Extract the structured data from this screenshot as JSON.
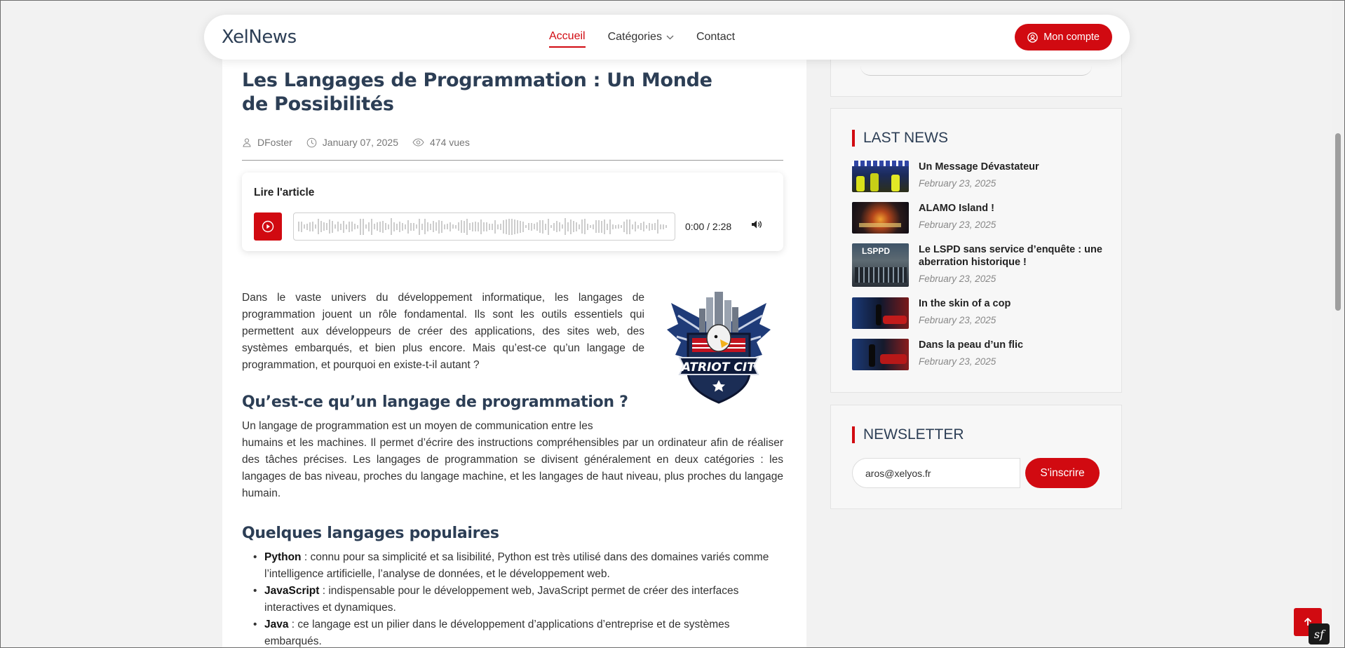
{
  "header": {
    "brand": "XelNews",
    "nav": [
      {
        "label": "Accueil"
      },
      {
        "label": "Catégories"
      },
      {
        "label": "Contact"
      }
    ],
    "account_label": "Mon compte"
  },
  "article": {
    "title": "Les Langages de Programmation : Un Monde de Possibilités",
    "author": "DFoster",
    "date": "January 07, 2025",
    "views": "474 vues",
    "player": {
      "label": "Lire l'article",
      "time": "0:00 / 2:28"
    },
    "logo_text": "PATRIOT CITY",
    "intro": "Dans le vaste univers du développement informatique, les langages de programmation jouent un rôle fondamental. Ils sont les outils essentiels qui permettent aux développeurs de créer des applications, des sites web, des systèmes embarqués, et bien plus encore. Mais qu’est-ce qu’un langage de programmation, et pourquoi en existe-t-il autant ?",
    "section1_title": "Qu’est-ce qu’un langage de programmation ?",
    "section1_first": "Un langage de programmation est un moyen de communication entre les",
    "section1_rest": "humains et les machines. Il permet d’écrire des instructions compréhensibles par un ordinateur afin de réaliser des tâches précises. Les langages de programmation se divisent généralement en deux catégories : les langages de bas niveau, proches du langage machine, et les langages de haut niveau, plus proches du langage humain.",
    "section2_title": "Quelques langages populaires",
    "languages": [
      {
        "name": "Python",
        "desc": " : connu pour sa simplicité et sa lisibilité, Python est très utilisé dans des domaines variés comme l’intelligence artificielle, l’analyse de données, et le développement web."
      },
      {
        "name": "JavaScript",
        "desc": " : indispensable pour le développement web, JavaScript permet de créer des interfaces interactives et dynamiques."
      },
      {
        "name": "Java",
        "desc": " : ce langage est un pilier dans le développement d’applications d’entreprise et de systèmes embarqués."
      }
    ]
  },
  "sidebar": {
    "last_news_title": "LAST NEWS",
    "news": [
      {
        "title": "Un Message Dévastateur",
        "date": "February 23, 2025"
      },
      {
        "title": "ALAMO Island !",
        "date": "February 23, 2025"
      },
      {
        "title": "Le LSPD sans service d’enquête : une aberration historique !",
        "date": "February 23, 2025",
        "thumb_text": "LSPPD"
      },
      {
        "title": "In the skin of a cop",
        "date": "February 23, 2025"
      },
      {
        "title": "Dans la peau d’un flic",
        "date": "February 23, 2025"
      }
    ],
    "newsletter_title": "NEWSLETTER",
    "newsletter_value": "aros@xelyos.fr",
    "newsletter_button": "S'inscrire"
  },
  "colors": {
    "accent": "#d10a11",
    "heading": "#2c3e55"
  },
  "icons": [
    "user-icon",
    "clock-icon",
    "eye-icon",
    "play-icon",
    "volume-icon",
    "user-circle-icon",
    "chevron-down-icon",
    "arrow-up-icon",
    "symfony-icon"
  ],
  "debug_badge": "sf"
}
